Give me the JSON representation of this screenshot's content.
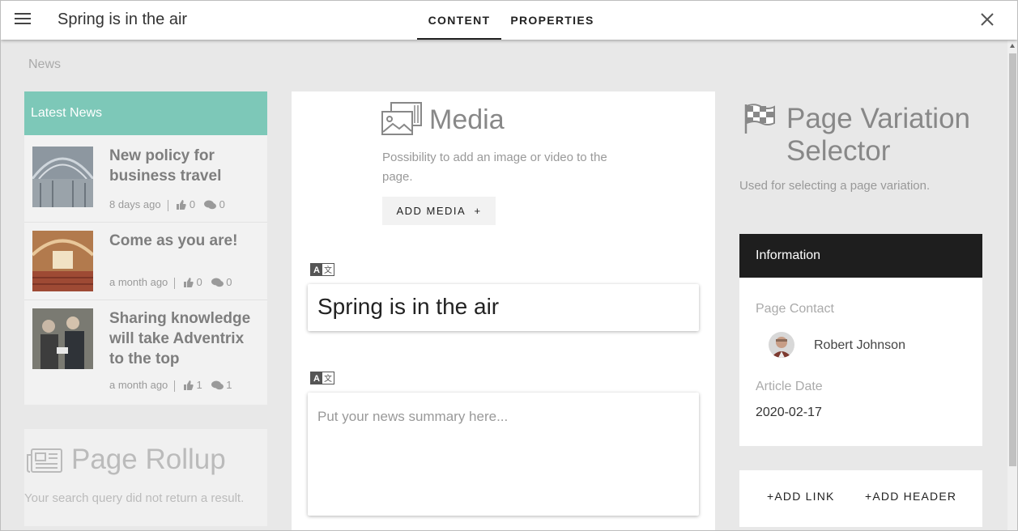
{
  "header": {
    "title": "Spring is in the air",
    "tabs": [
      {
        "label": "CONTENT",
        "active": true
      },
      {
        "label": "PROPERTIES",
        "active": false
      }
    ]
  },
  "breadcrumb": "News",
  "latest_news": {
    "heading": "Latest News",
    "items": [
      {
        "title": "New policy for business travel",
        "time": "8 days ago",
        "likes": "0",
        "comments": "0"
      },
      {
        "title": "Come as you are!",
        "time": "a month ago",
        "likes": "0",
        "comments": "0"
      },
      {
        "title": "Sharing knowledge will take Adventrix to the top",
        "time": "a month ago",
        "likes": "1",
        "comments": "1"
      }
    ]
  },
  "page_rollup": {
    "title": "Page Rollup",
    "message": "Your search query did not return a result."
  },
  "media": {
    "title": "Media",
    "description": "Possibility to add an image or video to the page.",
    "button": "ADD MEDIA"
  },
  "editor": {
    "title_value": "Spring is in the air",
    "summary_placeholder": "Put your news summary here..."
  },
  "page_variation": {
    "title": "Page Variation Selector",
    "description": "Used for selecting a page variation."
  },
  "information": {
    "heading": "Information",
    "contact_label": "Page Contact",
    "contact_name": "Robert Johnson",
    "date_label": "Article Date",
    "date_value": "2020-02-17"
  },
  "links": {
    "add_link": "ADD LINK",
    "add_header": "ADD HEADER"
  },
  "colors": {
    "accent": "#7dc8b8",
    "info_header": "#1e1e1e"
  }
}
